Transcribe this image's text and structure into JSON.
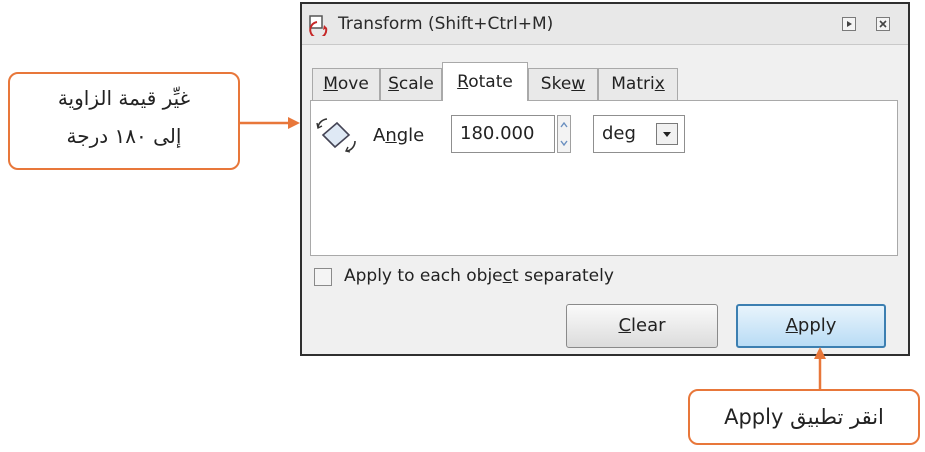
{
  "window": {
    "title": "Transform (Shift+Ctrl+M)"
  },
  "tabs": [
    {
      "label": "Move",
      "mnemonic_index": 0,
      "active": false
    },
    {
      "label": "Scale",
      "mnemonic_index": 0,
      "active": false
    },
    {
      "label": "Rotate",
      "mnemonic_index": 0,
      "active": true
    },
    {
      "label": "Skew",
      "mnemonic_index": 3,
      "active": false
    },
    {
      "label": "Matrix",
      "mnemonic_index": 5,
      "active": false
    }
  ],
  "rotate": {
    "angle_label": "Angle",
    "angle_value": "180.000",
    "unit": "deg"
  },
  "options": {
    "apply_each_label": "Apply to each object separately",
    "apply_each_checked": false
  },
  "buttons": {
    "clear": "Clear",
    "apply": "Apply"
  },
  "callouts": {
    "angle_line1": "غيِّر قيمة الزاوية",
    "angle_line2": "إلى ١٨٠ درجة",
    "apply_text": "انقر تطبيق Apply"
  },
  "colors": {
    "callout_accent": "#e8773a",
    "apply_border": "#3c7fb1"
  }
}
